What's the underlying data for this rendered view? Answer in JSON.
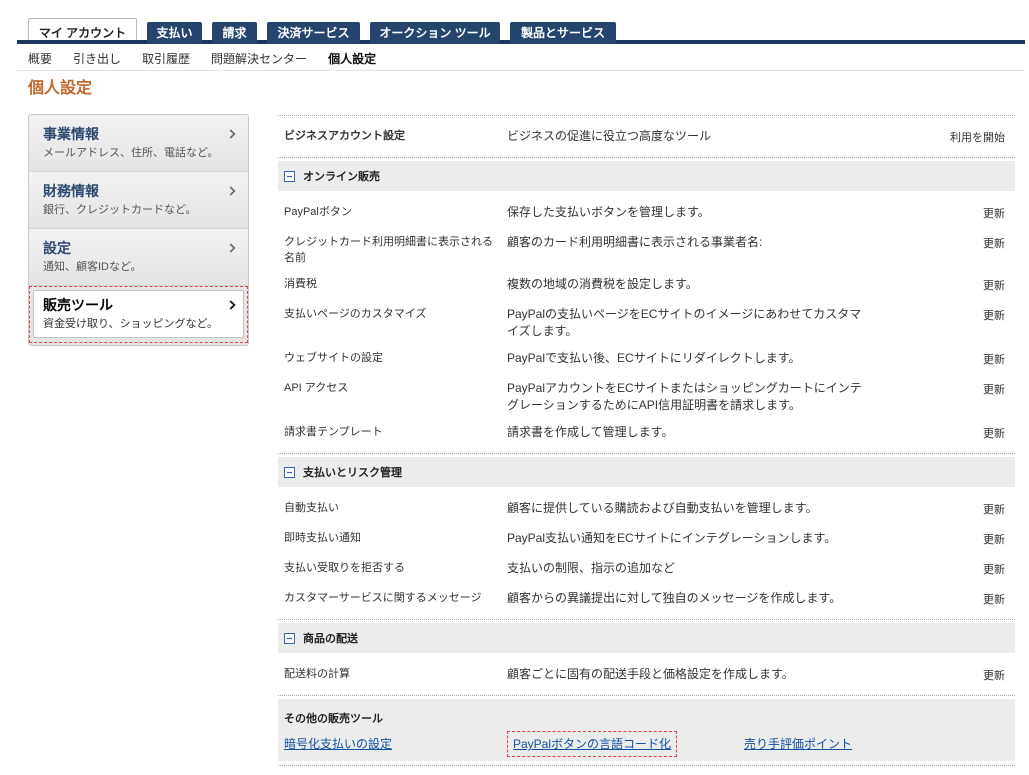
{
  "tabs": [
    {
      "label": "マイ アカウント",
      "active": true
    },
    {
      "label": "支払い"
    },
    {
      "label": "請求"
    },
    {
      "label": "決済サービス"
    },
    {
      "label": "オークション ツール"
    },
    {
      "label": "製品とサービス"
    }
  ],
  "subnav": {
    "items": [
      {
        "label": "概要"
      },
      {
        "label": "引き出し"
      },
      {
        "label": "取引履歴"
      },
      {
        "label": "問題解決センター"
      },
      {
        "label": "個人設定",
        "current": true
      }
    ]
  },
  "page_title": "個人設定",
  "sidebar": {
    "items": [
      {
        "title": "事業情報",
        "subtitle": "メールアドレス、住所、電話など。"
      },
      {
        "title": "財務情報",
        "subtitle": "銀行、クレジットカードなど。"
      },
      {
        "title": "設定",
        "subtitle": "通知、顧客IDなど。"
      },
      {
        "title": "販売ツール",
        "subtitle": "資金受け取り、ショッピングなど。",
        "active": true,
        "highlighted": true
      }
    ]
  },
  "main": {
    "business_settings": {
      "label": "ビジネスアカウント設定",
      "description": "ビジネスの促進に役立つ高度なツール",
      "action": "利用を開始"
    },
    "sections": [
      {
        "title": "オンライン販売",
        "rows": [
          {
            "label": "PayPalボタン",
            "description": "保存した支払いボタンを管理します。",
            "action": "更新"
          },
          {
            "label": "クレジットカード利用明細書に表示される名前",
            "description": "顧客のカード利用明細書に表示される事業者名:",
            "action": "更新"
          },
          {
            "label": "消費税",
            "description": "複数の地域の消費税を設定します。",
            "action": "更新"
          },
          {
            "label": "支払いページのカスタマイズ",
            "description": "PayPalの支払いページをECサイトのイメージにあわせてカスタマイズします。",
            "action": "更新"
          },
          {
            "label": "ウェブサイトの設定",
            "description": "PayPalで支払い後、ECサイトにリダイレクトします。",
            "action": "更新"
          },
          {
            "label": "API アクセス",
            "description": "PayPalアカウントをECサイトまたはショッピングカートにインテグレーションするためにAPI信用証明書を請求します。",
            "action": "更新"
          },
          {
            "label": "請求書テンプレート",
            "description": "請求書を作成して管理します。",
            "action": "更新"
          }
        ]
      },
      {
        "title": "支払いとリスク管理",
        "rows": [
          {
            "label": "自動支払い",
            "description": "顧客に提供している購読および自動支払いを管理します。",
            "action": "更新"
          },
          {
            "label": "即時支払い通知",
            "description": "PayPal支払い通知をECサイトにインテグレーションします。",
            "action": "更新"
          },
          {
            "label": "支払い受取りを拒否する",
            "description": "支払いの制限、指示の追加など",
            "action": "更新"
          },
          {
            "label": "カスタマーサービスに関するメッセージ",
            "description": "顧客からの異議提出に対して独自のメッセージを作成します。",
            "action": "更新"
          }
        ]
      },
      {
        "title": "商品の配送",
        "rows": [
          {
            "label": "配送料の計算",
            "description": "顧客ごとに固有の配送手段と価格設定を作成します。",
            "action": "更新"
          }
        ]
      }
    ],
    "other_tools": {
      "title": "その他の販売ツール",
      "links": [
        {
          "label": "暗号化支払いの設定"
        },
        {
          "label": "PayPalボタンの言語コード化",
          "highlighted": true
        },
        {
          "label": "売り手評価ポイント"
        }
      ]
    }
  },
  "icons": {
    "sidebar_item": "chevron-right-icon",
    "section_toggle": "collapse-minus-icon"
  },
  "colors": {
    "tab_bg": "#25456f",
    "tab_bar": "#1c3660",
    "page_title": "#c1692c",
    "sidebar_title": "#2f4a72",
    "link": "#1450a0",
    "highlight": "#e04646",
    "section_bg": "#ececec"
  }
}
